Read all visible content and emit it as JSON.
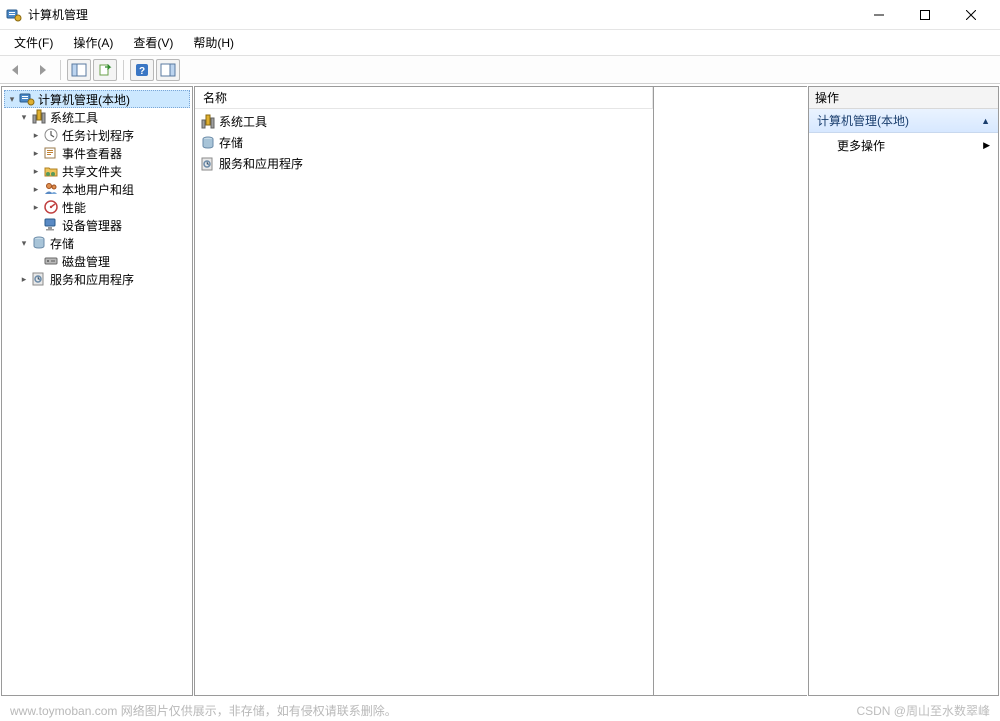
{
  "window": {
    "title": "计算机管理",
    "controls": {
      "min": "minimize-icon",
      "max": "maximize-icon",
      "close": "close-icon"
    }
  },
  "menubar": [
    {
      "label": "文件(F)"
    },
    {
      "label": "操作(A)"
    },
    {
      "label": "查看(V)"
    },
    {
      "label": "帮助(H)"
    }
  ],
  "toolbar": [
    {
      "name": "back-button",
      "icon": "arrow-left-icon"
    },
    {
      "name": "forward-button",
      "icon": "arrow-right-icon"
    },
    {
      "sep": true
    },
    {
      "name": "show-hide-tree-button",
      "icon": "console-tree-icon",
      "boxed": true
    },
    {
      "name": "export-button",
      "icon": "export-list-icon",
      "boxed": true
    },
    {
      "sep": true
    },
    {
      "name": "help-button",
      "icon": "help-icon",
      "boxed": true
    },
    {
      "name": "show-action-pane-button",
      "icon": "action-pane-icon",
      "boxed": true
    }
  ],
  "tree": {
    "root": {
      "label": "计算机管理(本地)",
      "icon": "computer-management-icon",
      "expanded": true,
      "selected": true,
      "children": [
        {
          "label": "系统工具",
          "icon": "system-tools-icon",
          "expanded": true,
          "children": [
            {
              "label": "任务计划程序",
              "icon": "task-scheduler-icon",
              "hasChildren": true
            },
            {
              "label": "事件查看器",
              "icon": "event-viewer-icon",
              "hasChildren": true
            },
            {
              "label": "共享文件夹",
              "icon": "shared-folders-icon",
              "hasChildren": true
            },
            {
              "label": "本地用户和组",
              "icon": "local-users-icon",
              "hasChildren": true
            },
            {
              "label": "性能",
              "icon": "performance-icon",
              "hasChildren": true
            },
            {
              "label": "设备管理器",
              "icon": "device-manager-icon"
            }
          ]
        },
        {
          "label": "存储",
          "icon": "storage-icon",
          "expanded": true,
          "children": [
            {
              "label": "磁盘管理",
              "icon": "disk-management-icon"
            }
          ]
        },
        {
          "label": "服务和应用程序",
          "icon": "services-apps-icon",
          "hasChildren": true
        }
      ]
    }
  },
  "list": {
    "header": "名称",
    "items": [
      {
        "label": "系统工具",
        "icon": "system-tools-icon"
      },
      {
        "label": "存储",
        "icon": "storage-icon"
      },
      {
        "label": "服务和应用程序",
        "icon": "services-apps-icon"
      }
    ]
  },
  "actions": {
    "header": "操作",
    "group": "计算机管理(本地)",
    "more": "更多操作"
  },
  "footer": {
    "left": "www.toymoban.com 网络图片仅供展示，非存储，如有侵权请联系删除。",
    "right": "CSDN @周山至水数翠峰"
  }
}
